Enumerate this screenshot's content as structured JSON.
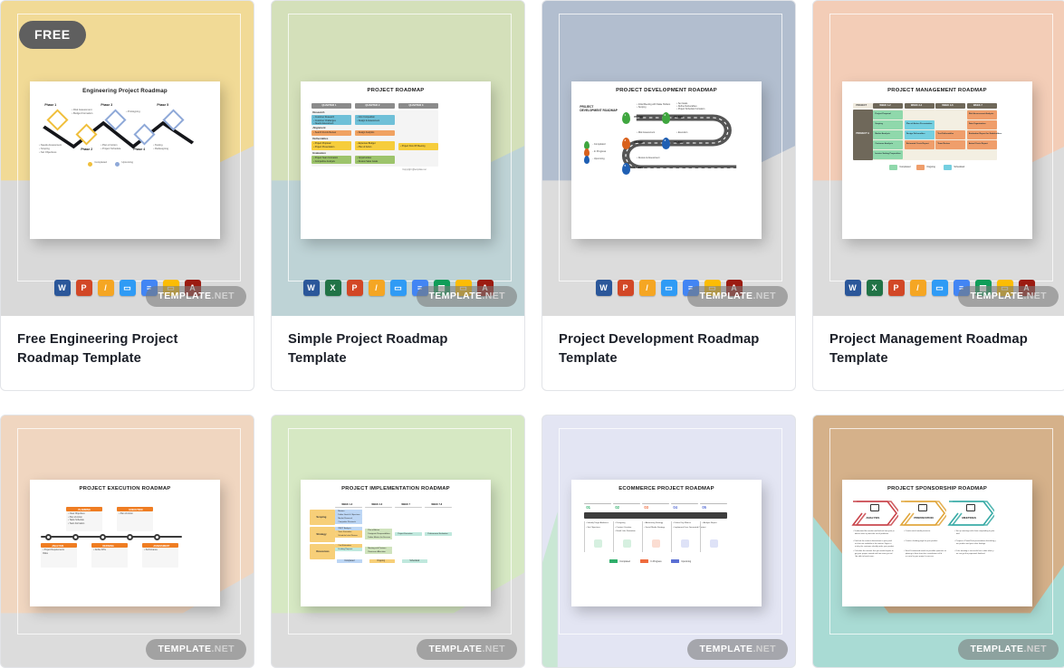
{
  "page": {
    "badge_free_label": "FREE",
    "watermark_main": "TEMPLATE",
    "watermark_tld": ".NET"
  },
  "format_icons": {
    "word": {
      "name": "ms-word-icon",
      "short": "W",
      "color": "#2b579a"
    },
    "excel": {
      "name": "ms-excel-icon",
      "short": "X",
      "color": "#217346"
    },
    "ppt": {
      "name": "ms-powerpoint-icon",
      "short": "P",
      "color": "#d24726"
    },
    "pages": {
      "name": "apple-pages-icon",
      "short": "/",
      "color": "#f5a623"
    },
    "keynote": {
      "name": "apple-keynote-icon",
      "short": "▭",
      "color": "#2f9bf5"
    },
    "gdocs": {
      "name": "google-docs-icon",
      "short": "≡",
      "color": "#4285f4"
    },
    "gsheets": {
      "name": "google-sheets-icon",
      "short": "▦",
      "color": "#0f9d58"
    },
    "gslides": {
      "name": "google-slides-icon",
      "short": "▭",
      "color": "#fbbc04"
    },
    "pdf": {
      "name": "pdf-icon",
      "short": "A",
      "color": "#9c1b11"
    }
  },
  "cards": [
    {
      "id": "free-engineering-project-roadmap",
      "title": "Free Engineering Project Roadmap Template",
      "is_free": true,
      "sheet_color": "#f1da96",
      "base_color": "#d9d9d9",
      "doc_title": "Engineering Project Roadmap",
      "doc_kind": "zigzag-diamond",
      "formats": [
        "word",
        "ppt",
        "pages",
        "keynote",
        "gdocs",
        "gslides",
        "pdf"
      ],
      "doc_labels": {
        "phases": [
          "Phase 1",
          "Phase 2",
          "Phase 3",
          "Phase 4",
          "Phase 5"
        ],
        "bullets_left": [
          "Needs Assessment",
          "Scoping",
          "Set Objectives"
        ],
        "bullets_p1": [
          "Risk Assessment",
          "Budget Formation"
        ],
        "bullets_p3": [
          "Plan of Action",
          "Project Schedule"
        ],
        "bullets_p4": [
          "Prototyping"
        ],
        "bullets_p5": [
          "Testing",
          "Redesigning"
        ],
        "legend": [
          "Completed",
          "Upcoming"
        ]
      }
    },
    {
      "id": "simple-project-roadmap",
      "title": "Simple Project Roadmap Template",
      "is_free": false,
      "sheet_color": "#d4e0ba",
      "base_color": "#bed3d6",
      "doc_title": "PROJECT ROADMAP",
      "doc_kind": "quarter-table",
      "formats": [
        "word",
        "excel",
        "ppt",
        "pages",
        "keynote",
        "gdocs",
        "gsheets",
        "gslides",
        "pdf"
      ],
      "doc_labels": {
        "columns": [
          "QUARTER 1",
          "QUARTER 2",
          "QUARTER 3"
        ],
        "sections": [
          "Research",
          "Alignment",
          "Deliverables",
          "Evaluation"
        ],
        "cells": [
          "Customer Research",
          "Customer Challenges",
          "Needs Assessment",
          "Intro Competition",
          "Design & Assessment",
          "Search Funds Review",
          "Design Analytics",
          "Project Proposal",
          "Project Presentation",
          "Expenses Budget",
          "Plan of Action",
          "Project Kick-Off Meeting",
          "Project Team Formation",
          "Competitive Analysis",
          "Opportunities",
          "Review Sales Goals"
        ],
        "copyright": "Copyright @template.net"
      }
    },
    {
      "id": "project-development-roadmap",
      "title": "Project Development Roadmap Template",
      "is_free": false,
      "sheet_color": "#b2becf",
      "base_color": "#dcdcdc",
      "doc_title": "PROJECT DEVELOPMENT ROADMAP",
      "doc_kind": "snake-pins",
      "formats": [
        "word",
        "ppt",
        "pages",
        "keynote",
        "gdocs",
        "gslides",
        "pdf"
      ],
      "doc_labels": {
        "phase_label": "PHASE",
        "pins": [
          "1",
          "2",
          "3",
          "4",
          "5"
        ],
        "notes": [
          "Initial Meeting with Stake Holders",
          "Scoping",
          "Set Goals",
          "Define Deliverables",
          "Project Schedule Formation",
          "Risk Assessment",
          "Execution",
          "Review & Assessment"
        ],
        "legend": [
          "Completed",
          "In Progress",
          "Upcoming"
        ]
      }
    },
    {
      "id": "project-management-roadmap",
      "title": "Project Management Roadmap Template",
      "is_free": false,
      "sheet_color": "#f3cdb7",
      "base_color": "#dcdcdc",
      "doc_title": "PROJECT MANAGEMENT ROADMAP",
      "doc_kind": "weeks-grid",
      "formats": [
        "word",
        "excel",
        "ppt",
        "pages",
        "keynote",
        "gdocs",
        "gsheets",
        "gslides",
        "pdf"
      ],
      "doc_labels": {
        "corner": "PROJECT",
        "columns": [
          "WEEK 1-2",
          "WEEK 3-4",
          "WEEK 4-6",
          "WEEK 7"
        ],
        "row_label": "PROJECT A",
        "cells": [
          "Project Proposal",
          "Risk Assessment Analysis",
          "Scoping",
          "Plan of Action Presentation",
          "Data Organization",
          "Market Analysis",
          "Design Deliverables",
          "Test Deliverables",
          "Evaluation Report for Stakeholders",
          "Customer Analysis",
          "Estimated Costs Report",
          "Team Review",
          "Actual Costs Report",
          "Invoice Setting Proposition"
        ],
        "legend": [
          "Completed",
          "Ongoing",
          "Scheduled"
        ]
      }
    },
    {
      "id": "project-execution-roadmap",
      "title": "Project Execution Roadmap Template",
      "is_free": false,
      "sheet_color": "#f0d6c0",
      "base_color": "#dcdcdc",
      "doc_title": "PROJECT EXECUTION ROADMAP",
      "doc_kind": "timeline-cards",
      "formats": [],
      "doc_labels": {
        "stages": [
          "PLANNING",
          "EXECUTION",
          "ANALYSIS",
          "DEFINING",
          "ASSESSMENT"
        ],
        "bullets": [
          "Clear Objectives",
          "Plan of Action",
          "Tasks Schedule",
          "Team Formation",
          "Plan of Action",
          "Project Requirements",
          "Risks",
          "Define KPIs",
          "Performance"
        ]
      }
    },
    {
      "id": "project-implementation-roadmap",
      "title": "Project Implementation Roadmap Template",
      "is_free": false,
      "sheet_color": "#d6e8c3",
      "base_color": "#dcdcdc",
      "doc_title": "PROJECT IMPLEMENTATION ROADMAP",
      "doc_kind": "weeks-matrix",
      "formats": [],
      "doc_labels": {
        "columns": [
          "WEEK 1-3",
          "WEEK 4-6",
          "WEEK 7",
          "WEEK 7-8"
        ],
        "rows": [
          "Scoping",
          "Strategy",
          "Resources"
        ],
        "cells": [
          "Mission",
          "Define Goals & Objectives",
          "Market Research",
          "Competitor Research",
          "SWOT Analysis",
          "Team Formation",
          "Schedule Initial Review",
          "Cost Estimation",
          "Funding Request",
          "Plan of Action",
          "Designate Responsibilities",
          "Define Metrics for Success",
          "Project Execution",
          "Performance Evaluation",
          "Meeting with Partners",
          "Resources Allocation"
        ],
        "legend": [
          "Completed",
          "Ongoing",
          "Scheduled"
        ]
      }
    },
    {
      "id": "ecommerce-project-roadmap",
      "title": "Ecommerce Project Roadmap Template",
      "is_free": false,
      "sheet_color": "#e3e5f3",
      "base_color": "#c9e7d4",
      "doc_title": "ECOMMERCE PROJECT ROADMAP",
      "doc_kind": "numbered-road",
      "formats": [],
      "doc_labels": {
        "numbers": [
          "01",
          "02",
          "03",
          "04",
          "05"
        ],
        "columns": [
          [
            "Identify Target Audience",
            "Set Objectives"
          ],
          [
            "Designing",
            "Content Creation",
            "Email Lists Formation"
          ],
          [
            "Advertising Strategy",
            "Social Media Strategy"
          ],
          [
            "Define Key Metrics",
            "Implement User Generated Content"
          ],
          [
            "Analyze Report"
          ]
        ],
        "legend": [
          "Completed",
          "In Progress",
          "Upcoming"
        ]
      }
    },
    {
      "id": "project-sponsorship-roadmap",
      "title": "Project Sponsorship Roadmap Template",
      "is_free": false,
      "sheet_color": "#d5b18a",
      "base_color": "#a9dbd4",
      "doc_title": "PROJECT SPONSORSHIP ROADMAP",
      "doc_kind": "chevrons",
      "formats": [],
      "doc_labels": {
        "stages": [
          "ANALYSIS",
          "PREPARATION",
          "MEETINGS"
        ],
        "stage_colors": [
          "#c9444a",
          "#e0a53a",
          "#36aaa5"
        ],
        "bullets": [
          "Understand the market and find out how your products solve a particular set of problems.",
          "Find out the various alternatives to your product that are available in the market. Figure out why the customer should prefer your product as opposed to the ones available.",
          "Calculate the amount that you would require to get your project started and how soon you will be able to break even.",
          "Create social media presence.",
          "Create a landing page for your product.",
          "Send Customized emails to possible sponsors explaining to them how their contribution will be crucial to your project's success.",
          "Set up meetings with those responding to your mail.",
          "Prepare a PowerPoint presentation describing your product and your other findings.",
          "If the meeting is successful set a date when you can get the paperwork finalized."
        ]
      }
    }
  ]
}
